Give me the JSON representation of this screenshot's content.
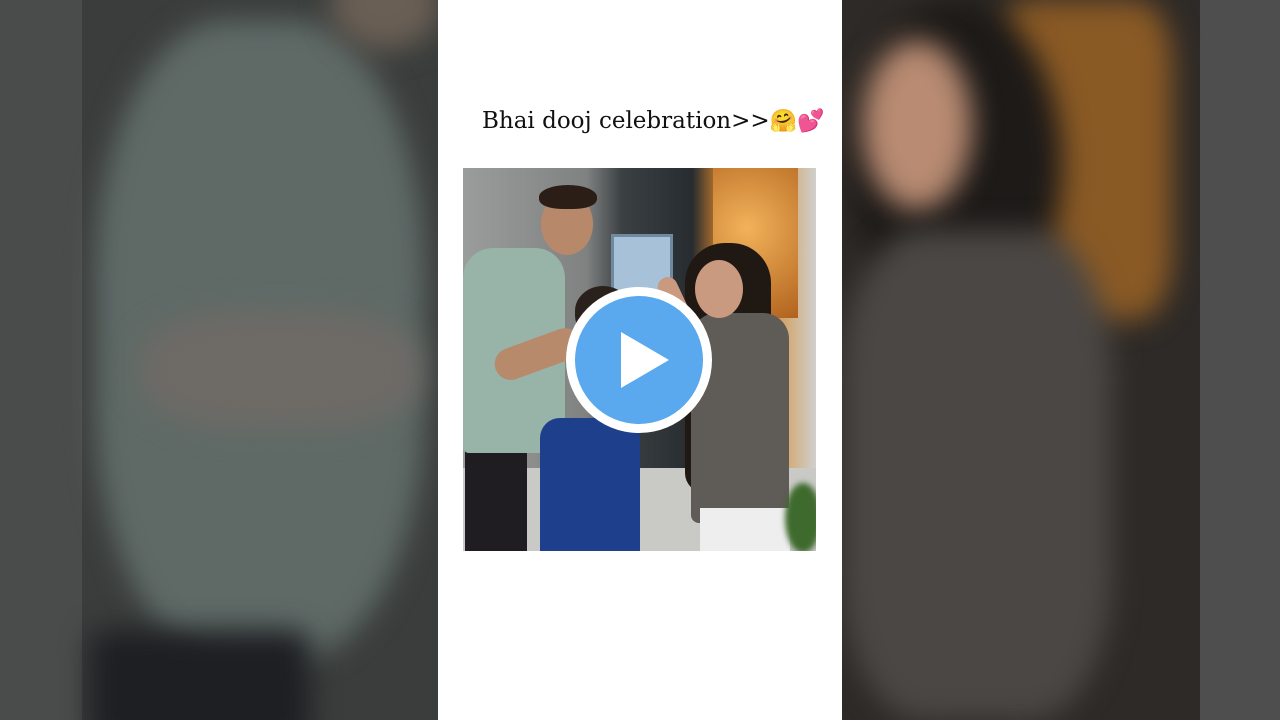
{
  "caption": {
    "text": "Bhai dooj celebration>>",
    "emoji_1": "🤗",
    "emoji_2": "💕"
  },
  "video": {
    "play_icon": "play-icon"
  },
  "colors": {
    "play_button": "#5aa8ee",
    "card_background": "#ffffff"
  }
}
